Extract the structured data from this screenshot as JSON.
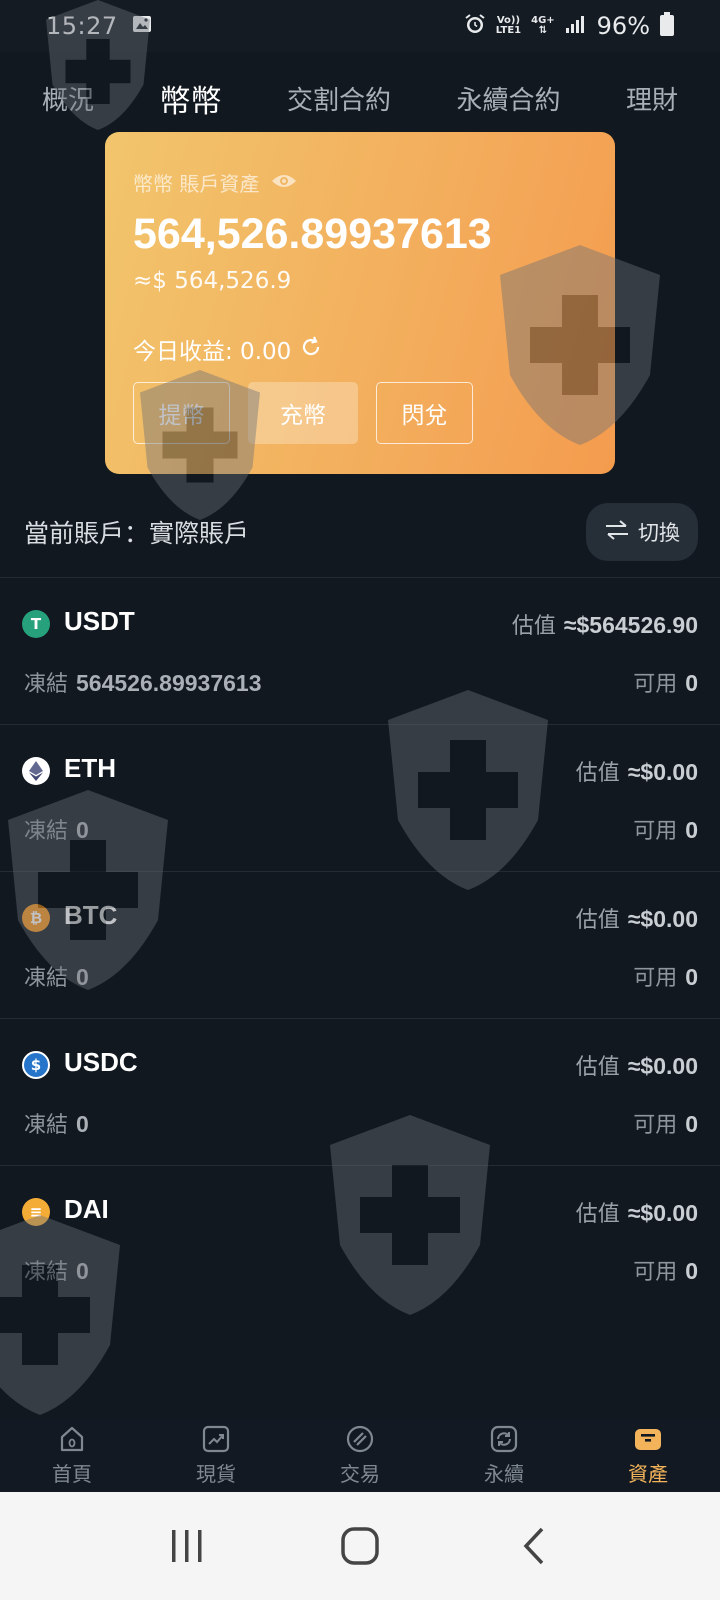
{
  "status_bar": {
    "time": "15:27",
    "network_top": "Vo))",
    "network_bottom": "LTE1",
    "network2": "4G+",
    "battery": "96%"
  },
  "top_tabs": [
    {
      "label": "概況",
      "active": false
    },
    {
      "label": "幣幣",
      "active": true
    },
    {
      "label": "交割合約",
      "active": false
    },
    {
      "label": "永續合約",
      "active": false
    },
    {
      "label": "理財",
      "active": false
    }
  ],
  "asset_card": {
    "label": "幣幣 賬戶資產",
    "balance": "564,526.89937613",
    "usd_value": "≈$ 564,526.9",
    "today_income": "今日收益: 0.00",
    "buttons": {
      "withdraw": "提幣",
      "deposit": "充幣",
      "convert": "閃兌"
    }
  },
  "account": {
    "label": "當前賬戶：實際賬戶",
    "switch_label": "切換"
  },
  "coins": [
    {
      "name": "USDT",
      "est_label": "估值",
      "est_value": "≈$564526.90",
      "frozen_label": "凍結",
      "frozen_value": "564526.89937613",
      "avail_label": "可用",
      "avail_value": "0",
      "icon_color": "#26a17b",
      "icon_glyph": "T"
    },
    {
      "name": "ETH",
      "est_label": "估值",
      "est_value": "≈$0.00",
      "frozen_label": "凍結",
      "frozen_value": "0",
      "avail_label": "可用",
      "avail_value": "0",
      "icon_color": "#ffffff",
      "icon_glyph": "◆"
    },
    {
      "name": "BTC",
      "est_label": "估值",
      "est_value": "≈$0.00",
      "frozen_label": "凍結",
      "frozen_value": "0",
      "avail_label": "可用",
      "avail_value": "0",
      "icon_color": "#f7931a",
      "icon_glyph": "₿"
    },
    {
      "name": "USDC",
      "est_label": "估值",
      "est_value": "≈$0.00",
      "frozen_label": "凍結",
      "frozen_value": "0",
      "avail_label": "可用",
      "avail_value": "0",
      "icon_color": "#2775ca",
      "icon_glyph": "$"
    },
    {
      "name": "DAI",
      "est_label": "估值",
      "est_value": "≈$0.00",
      "frozen_label": "凍結",
      "frozen_value": "0",
      "avail_label": "可用",
      "avail_value": "0",
      "icon_color": "#f5ac37",
      "icon_glyph": "≡"
    }
  ],
  "bottom_nav": [
    {
      "label": "首頁",
      "icon": "home-icon",
      "active": false
    },
    {
      "label": "現貨",
      "icon": "chart-trend-icon",
      "active": false
    },
    {
      "label": "交易",
      "icon": "trade-icon",
      "active": false
    },
    {
      "label": "永續",
      "icon": "refresh-cycle-icon",
      "active": false
    },
    {
      "label": "資產",
      "icon": "wallet-icon",
      "active": true
    }
  ],
  "colors": {
    "accent": "#f2b35a",
    "background": "#111820"
  }
}
